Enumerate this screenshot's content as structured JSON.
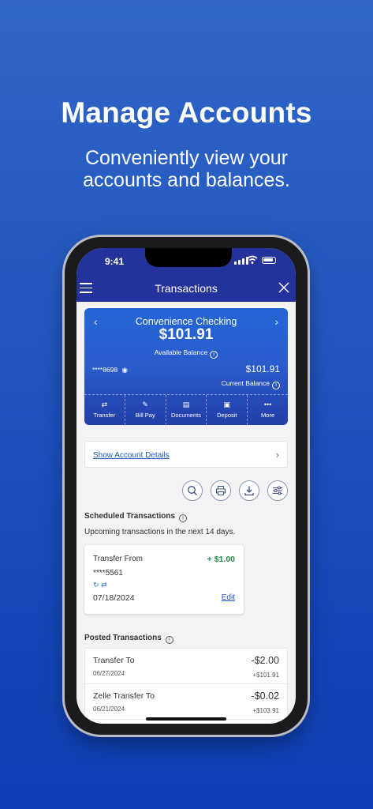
{
  "promo": {
    "headline": "Manage Accounts",
    "subline_1": "Conveniently view your",
    "subline_2": "accounts and balances."
  },
  "status_bar": {
    "time": "9:41"
  },
  "nav": {
    "title": "Transactions"
  },
  "account_card": {
    "name": "Convenience Checking",
    "balance": "$101.91",
    "available_label": "Available Balance",
    "masked_number": "****8698",
    "current_amount": "$101.91",
    "current_label": "Current Balance",
    "actions": [
      {
        "label": "Transfer",
        "icon": "⇄"
      },
      {
        "label": "Bill Pay",
        "icon": "✎"
      },
      {
        "label": "Documents",
        "icon": "▤"
      },
      {
        "label": "Deposit",
        "icon": "▣"
      },
      {
        "label": "More",
        "icon": "•••"
      }
    ]
  },
  "details_link": "Show Account Details",
  "scheduled": {
    "title": "Scheduled Transactions",
    "subtitle": "Upcoming transactions in the next 14 days.",
    "item": {
      "title": "Transfer From",
      "amount": "+ $1.00",
      "account": "****5561",
      "date": "07/18/2024",
      "edit": "Edit"
    }
  },
  "posted": {
    "title": "Posted Transactions",
    "items": [
      {
        "title": "Transfer To",
        "date": "06/27/2024",
        "amount": "-$2.00",
        "balance": "+$101.91"
      },
      {
        "title": "Zelle Transfer To",
        "date": "06/21/2024",
        "amount": "-$0.02",
        "balance": "+$103.91"
      }
    ]
  },
  "colors": {
    "brand_blue": "#24329b",
    "accent_green": "#2a8a4f",
    "link": "#2458c8"
  }
}
